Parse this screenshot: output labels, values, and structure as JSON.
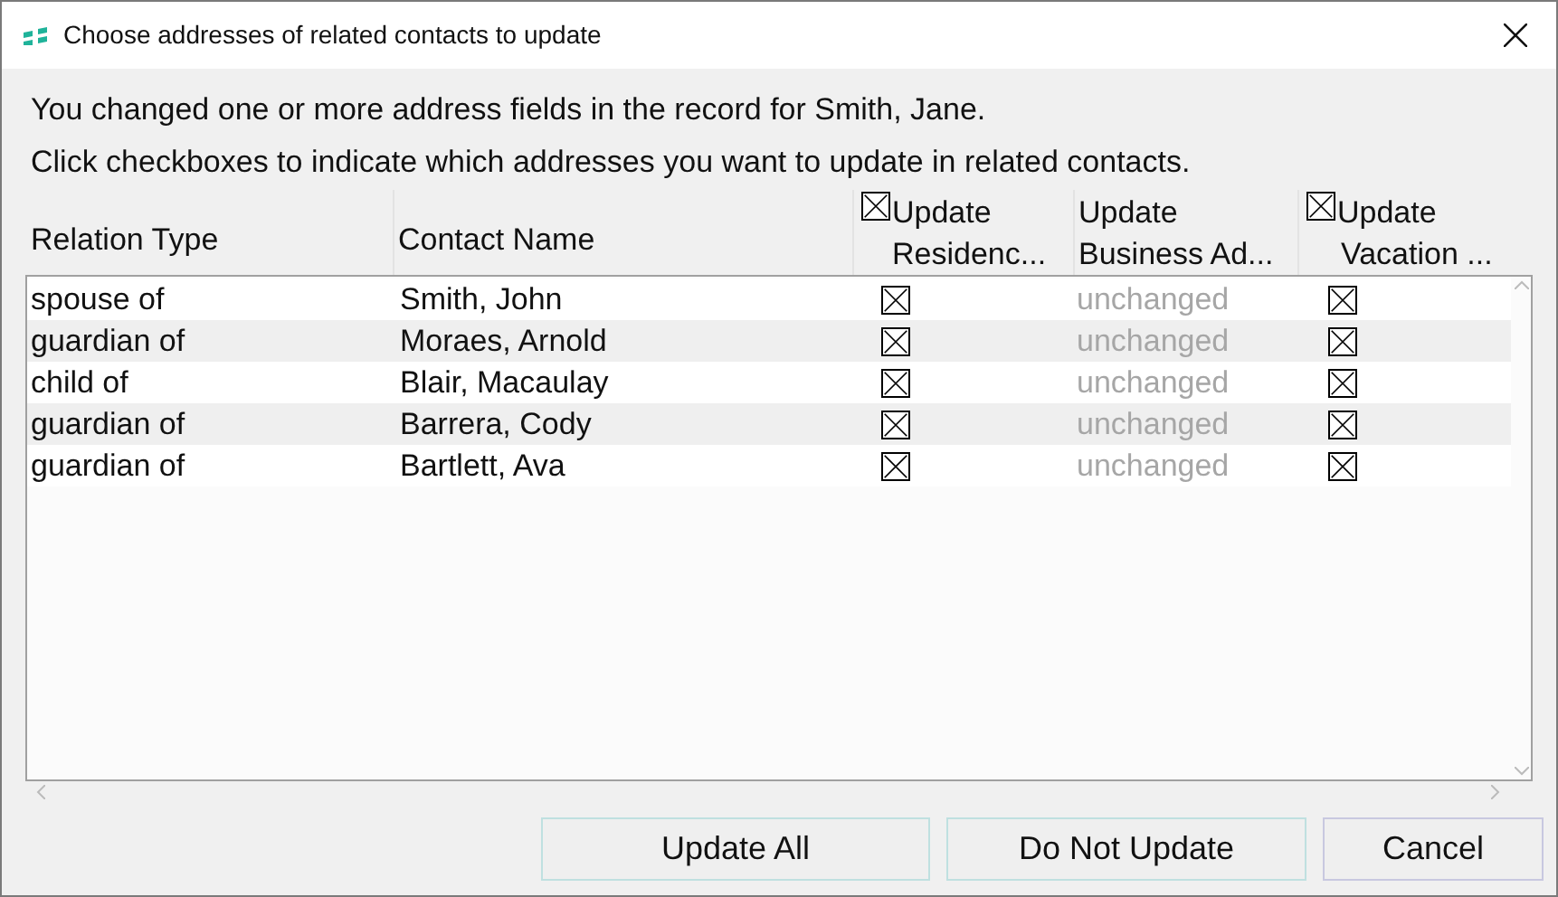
{
  "window": {
    "title": "Choose addresses of related contacts to update"
  },
  "message": [
    "You changed one or more address fields in the record for Smith, Jane.",
    "Click checkboxes to indicate which addresses you want to update in related contacts."
  ],
  "columns": [
    {
      "kind": "text",
      "line1": "Relation Type"
    },
    {
      "kind": "text",
      "line1": "Contact Name"
    },
    {
      "kind": "checkbox",
      "checked": true,
      "line1": "Update",
      "line2": "Residenc..."
    },
    {
      "kind": "text",
      "line1": "Update",
      "line2": "Business Ad..."
    },
    {
      "kind": "checkbox",
      "checked": true,
      "line1": "Update",
      "line2": "Vacation ..."
    }
  ],
  "rows": [
    {
      "relation_type": "spouse of",
      "contact_name": "Smith, John",
      "residence": {
        "checked": true
      },
      "business": {
        "text": "unchanged",
        "disabled": true
      },
      "vacation": {
        "checked": true
      }
    },
    {
      "relation_type": "guardian of",
      "contact_name": "Moraes, Arnold",
      "residence": {
        "checked": true
      },
      "business": {
        "text": "unchanged",
        "disabled": true
      },
      "vacation": {
        "checked": true
      }
    },
    {
      "relation_type": "child of",
      "contact_name": "Blair, Macaulay",
      "residence": {
        "checked": true
      },
      "business": {
        "text": "unchanged",
        "disabled": true
      },
      "vacation": {
        "checked": true
      }
    },
    {
      "relation_type": "guardian of",
      "contact_name": "Barrera, Cody",
      "residence": {
        "checked": true
      },
      "business": {
        "text": "unchanged",
        "disabled": true
      },
      "vacation": {
        "checked": true
      }
    },
    {
      "relation_type": "guardian of",
      "contact_name": "Bartlett, Ava",
      "residence": {
        "checked": true
      },
      "business": {
        "text": "unchanged",
        "disabled": true
      },
      "vacation": {
        "checked": true
      }
    }
  ],
  "buttons": [
    "Update All",
    "Do Not Update",
    "Cancel"
  ]
}
